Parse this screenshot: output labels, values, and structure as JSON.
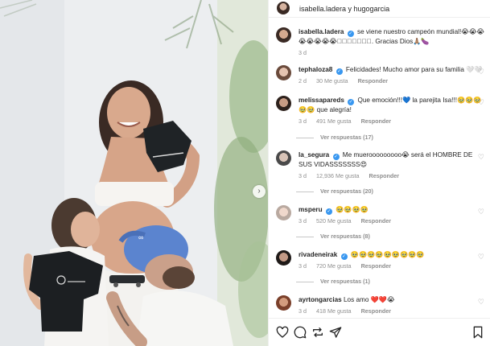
{
  "header": {
    "title": "isabella.ladera y hugogarcia"
  },
  "caption": {
    "username": "isabella.ladera",
    "text": "se viene nuestro campeón mundial!😭😭😭 😭😭😭😭😭􀀀􀀀􀀀􀀀􀀀􀀀􀀀. Gracias Dios🙏🏽🍆",
    "time": "3 d"
  },
  "comments": [
    {
      "username": "tephalozа8",
      "text": "Felicidades! Mucho amor para su familia 🤍🤍",
      "time": "2 d",
      "likes": "30 Me gusta",
      "reply": "Responder",
      "replies": ""
    },
    {
      "username": "melissapareds",
      "text": "Que emoción!!!💙 la parejita Isa!!!🥹🥹🥹 🥹🥹 que alegría!",
      "time": "3 d",
      "likes": "491 Me gusta",
      "reply": "Responder",
      "replies": "Ver respuestas (17)"
    },
    {
      "username": "la_segura",
      "text": "Me muerooooooooo😭 será el HOMBRE DE SUS VIDASSSSSSS😍",
      "time": "3 d",
      "likes": "12,936 Me gusta",
      "reply": "Responder",
      "replies": "Ver respuestas (20)"
    },
    {
      "username": "msperu",
      "text": "🥹🥹🥹🥹",
      "time": "3 d",
      "likes": "520 Me gusta",
      "reply": "Responder",
      "replies": "Ver respuestas (8)"
    },
    {
      "username": "rivadeneirak",
      "text": "🥹🥹🥹🥹🥹🥹🥹🥹🥹",
      "time": "3 d",
      "likes": "720 Me gusta",
      "reply": "Responder",
      "replies": "Ver respuestas (1)"
    },
    {
      "username": "ayrtongarcias",
      "text": "Los amo ❤️❤️😭",
      "time": "3 d",
      "likes": "418 Me gusta",
      "reply": "Responder",
      "replies": ""
    }
  ],
  "icons": {
    "like": "heart-icon",
    "comment": "comment-bubble-icon",
    "share": "paper-plane-icon",
    "save": "bookmark-icon",
    "next": "chevron-right-icon"
  },
  "colors": {
    "verified": "#3897f0",
    "muted": "#8e8e8e",
    "text": "#262626",
    "cap": "#4a78c8"
  }
}
